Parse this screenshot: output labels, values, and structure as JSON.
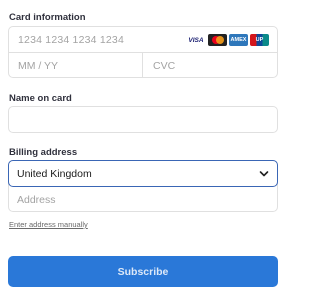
{
  "card_information": {
    "label": "Card information",
    "number_placeholder": "1234 1234 1234 1234",
    "expiry_placeholder": "MM / YY",
    "cvc_placeholder": "CVC",
    "brands": [
      {
        "name": "visa",
        "text": "VISA"
      },
      {
        "name": "mastercard",
        "text": ""
      },
      {
        "name": "amex",
        "text": "AMEX"
      },
      {
        "name": "unionpay",
        "text": "UP"
      }
    ]
  },
  "name_on_card": {
    "label": "Name on card",
    "value": ""
  },
  "billing_address": {
    "label": "Billing address",
    "country_selected": "United Kingdom",
    "address_placeholder": "Address",
    "manual_link": "Enter address manually"
  },
  "actions": {
    "subscribe_label": "Subscribe"
  },
  "colors": {
    "accent": "#2a78d8",
    "focus_border": "#3a66b5",
    "border": "#e0e0e0",
    "placeholder": "#a3a3a3"
  }
}
